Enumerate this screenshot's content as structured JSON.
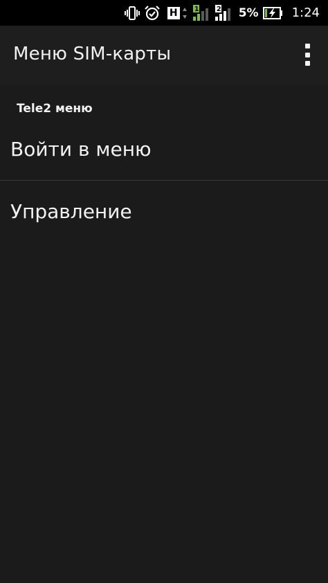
{
  "status_bar": {
    "icons": [
      "vibrate-icon",
      "alarm-icon",
      "h-network-icon",
      "data-arrows-icon",
      "signal-sim1-icon",
      "signal-sim2-icon",
      "battery-charging-icon"
    ],
    "h_badge": "H",
    "sim1_number": "1",
    "sim2_number": "2",
    "battery_percent": "5%",
    "time": "1:24",
    "colors": {
      "signal_active": "#7ac143",
      "signal_inactive": "#5a5a5a",
      "battery_fill": "#7ac143"
    }
  },
  "app_bar": {
    "title": "Меню SIM-карты",
    "overflow_icon": "more-vert-icon"
  },
  "content": {
    "section_header": "Tele2 меню",
    "items": [
      {
        "label": "Войти в меню"
      },
      {
        "label": "Управление"
      }
    ]
  }
}
